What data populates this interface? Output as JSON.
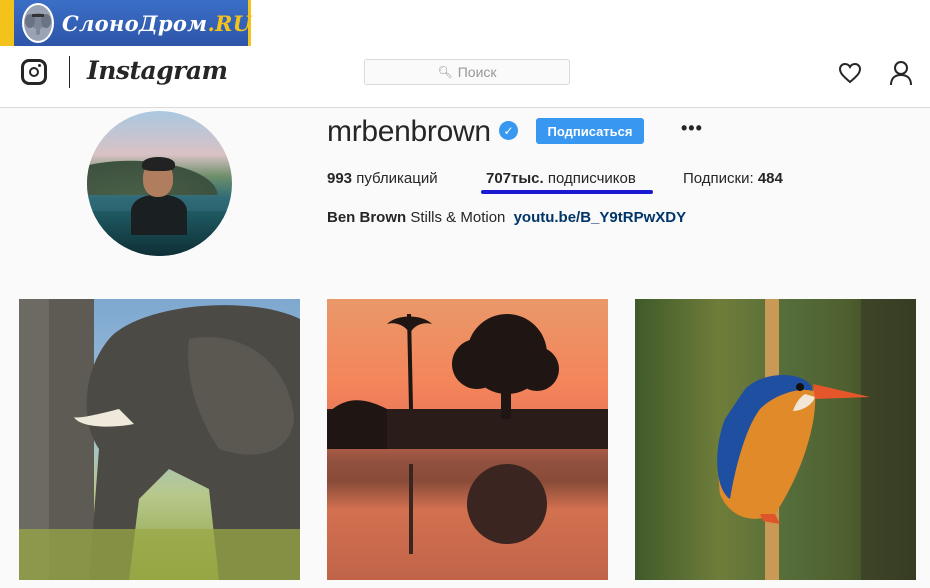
{
  "watermark": {
    "brand_main": "СлоноДром",
    "brand_suffix": ".RU"
  },
  "nav": {
    "logo_text": "Instagram",
    "search_placeholder": "Поиск",
    "icons": [
      "instagram-camera-icon",
      "search-icon",
      "heart-icon",
      "user-icon"
    ]
  },
  "profile": {
    "username": "mrbenbrown",
    "verified_mark": "✓",
    "follow_label": "Подписаться",
    "more_label": "•••",
    "stats": {
      "posts_count": "993",
      "posts_label": "публикаций",
      "followers_count": "707тыс.",
      "followers_label": "подписчиков",
      "following_label": "Подписки:",
      "following_count": "484"
    },
    "bio": {
      "name": "Ben Brown",
      "text": "Stills & Motion",
      "link": "youtu.be/B_Y9tRPwXDY"
    }
  },
  "colors": {
    "accent_blue": "#3897f0",
    "highlight_underline": "#1a1ad4",
    "link": "#003569",
    "banner_blue": "#2d55a8",
    "banner_yellow": "#f3c21b"
  },
  "posts": [
    {
      "subject": "elephant"
    },
    {
      "subject": "sunset-palms-reflection"
    },
    {
      "subject": "kingfisher"
    }
  ]
}
